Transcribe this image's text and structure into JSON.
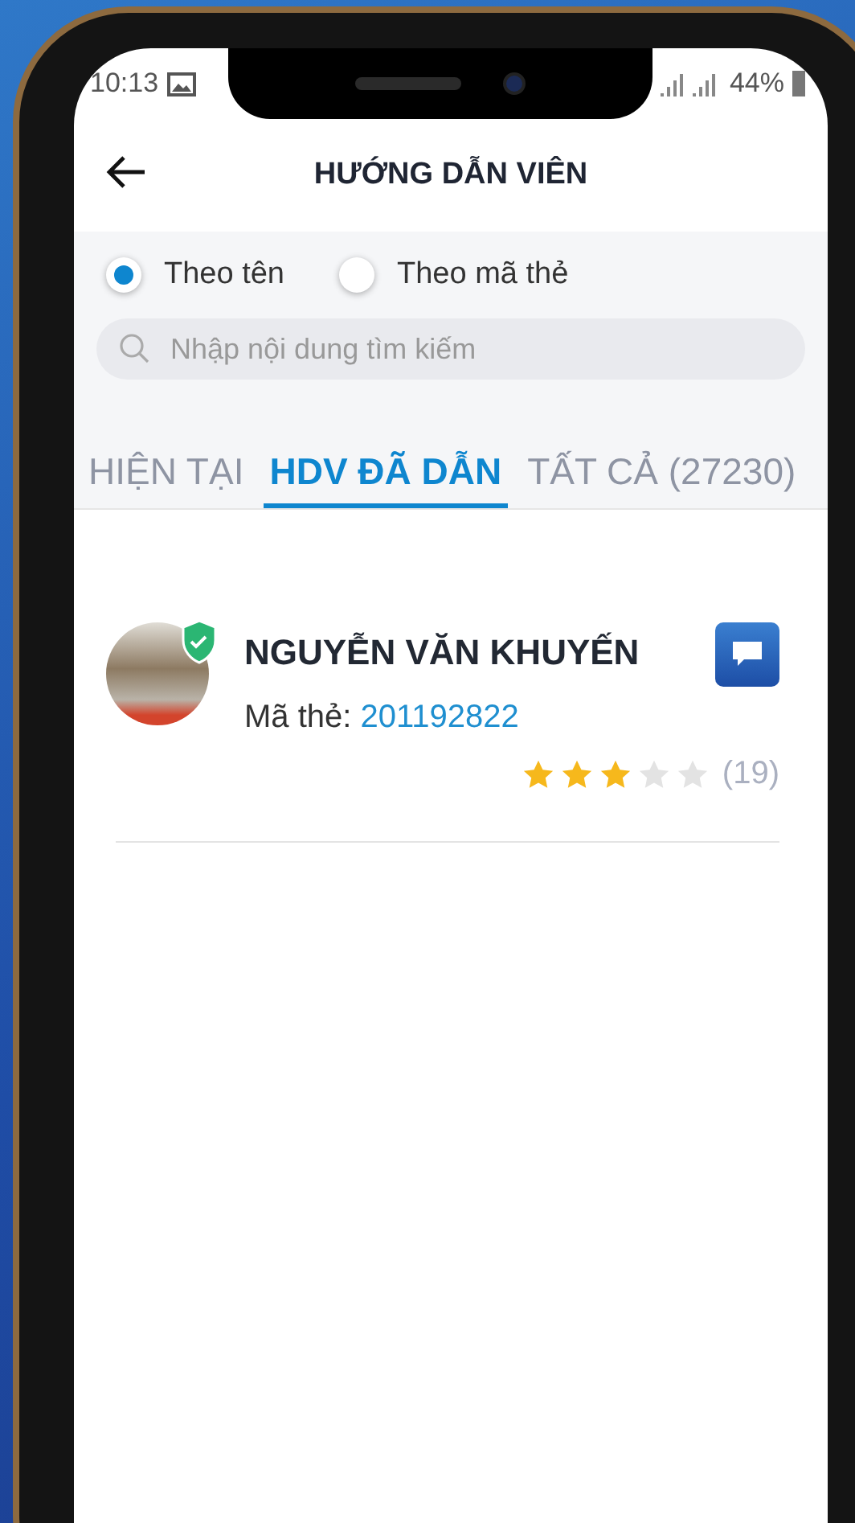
{
  "status_bar": {
    "time": "10:13",
    "battery": "44%"
  },
  "header": {
    "title": "HƯỚNG DẪN VIÊN"
  },
  "search_modes": [
    {
      "label": "Theo tên",
      "selected": true
    },
    {
      "label": "Theo mã thẻ",
      "selected": false
    }
  ],
  "search": {
    "placeholder": "Nhập nội dung tìm kiếm"
  },
  "tabs": [
    {
      "label": "HIỆN TẠI",
      "selected": false
    },
    {
      "label": "HDV ĐÃ DẪN",
      "selected": true
    },
    {
      "label": "TẤT CẢ (27230)",
      "selected": false
    }
  ],
  "guides": [
    {
      "name": "NGUYỄN VĂN KHUYẾN",
      "card_label": "Mã thẻ:",
      "card_number": "201192822",
      "verified": true,
      "stars": 3,
      "review_count": "(19)"
    }
  ]
}
